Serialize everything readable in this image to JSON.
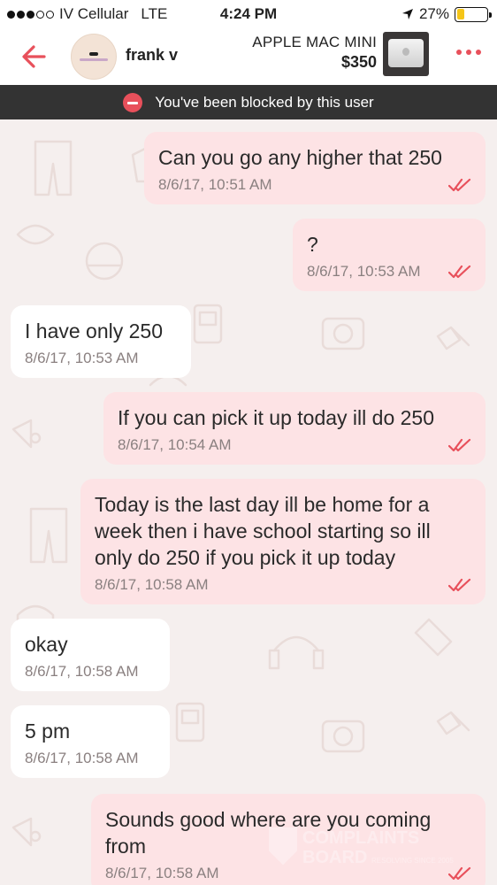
{
  "status_bar": {
    "carrier": "IV Cellular",
    "network": "LTE",
    "time": "4:24 PM",
    "battery": "27%",
    "battery_level": 0.27
  },
  "header": {
    "username": "frank v",
    "product_name": "APPLE MAC MINI",
    "price": "$350"
  },
  "banner": {
    "text": "You've been blocked by this user"
  },
  "messages": [
    {
      "direction": "out",
      "text": "Can you go any higher that 250",
      "time": "8/6/17, 10:51 AM",
      "read": true
    },
    {
      "direction": "out",
      "text": "?",
      "time": "8/6/17, 10:53 AM",
      "read": true
    },
    {
      "direction": "in",
      "text": "I have only 250",
      "time": "8/6/17, 10:53 AM"
    },
    {
      "direction": "out",
      "text": "If you can pick it up today ill do 250",
      "time": "8/6/17, 10:54 AM",
      "read": true
    },
    {
      "direction": "out",
      "text": "Today is the last day ill be home for a week then i have school starting so ill only do 250 if you pick it up today",
      "time": "8/6/17, 10:58 AM",
      "read": true
    },
    {
      "direction": "in",
      "text": "okay",
      "time": "8/6/17, 10:58 AM"
    },
    {
      "direction": "in",
      "text": "5 pm",
      "time": "8/6/17, 10:58 AM"
    },
    {
      "direction": "out",
      "text": "Sounds good where are you coming from",
      "time": "8/6/17, 10:58 AM",
      "read": true
    }
  ],
  "watermark": {
    "brand": "COMPLAINTS",
    "brand2": "BOARD",
    "tagline": "RESOLVING SINCE 2005"
  },
  "colors": {
    "accent": "#e8505b",
    "outgoing_bubble": "#fde3e5",
    "incoming_bubble": "#ffffff",
    "banner_bg": "#333333",
    "chat_bg": "#f5efee"
  }
}
